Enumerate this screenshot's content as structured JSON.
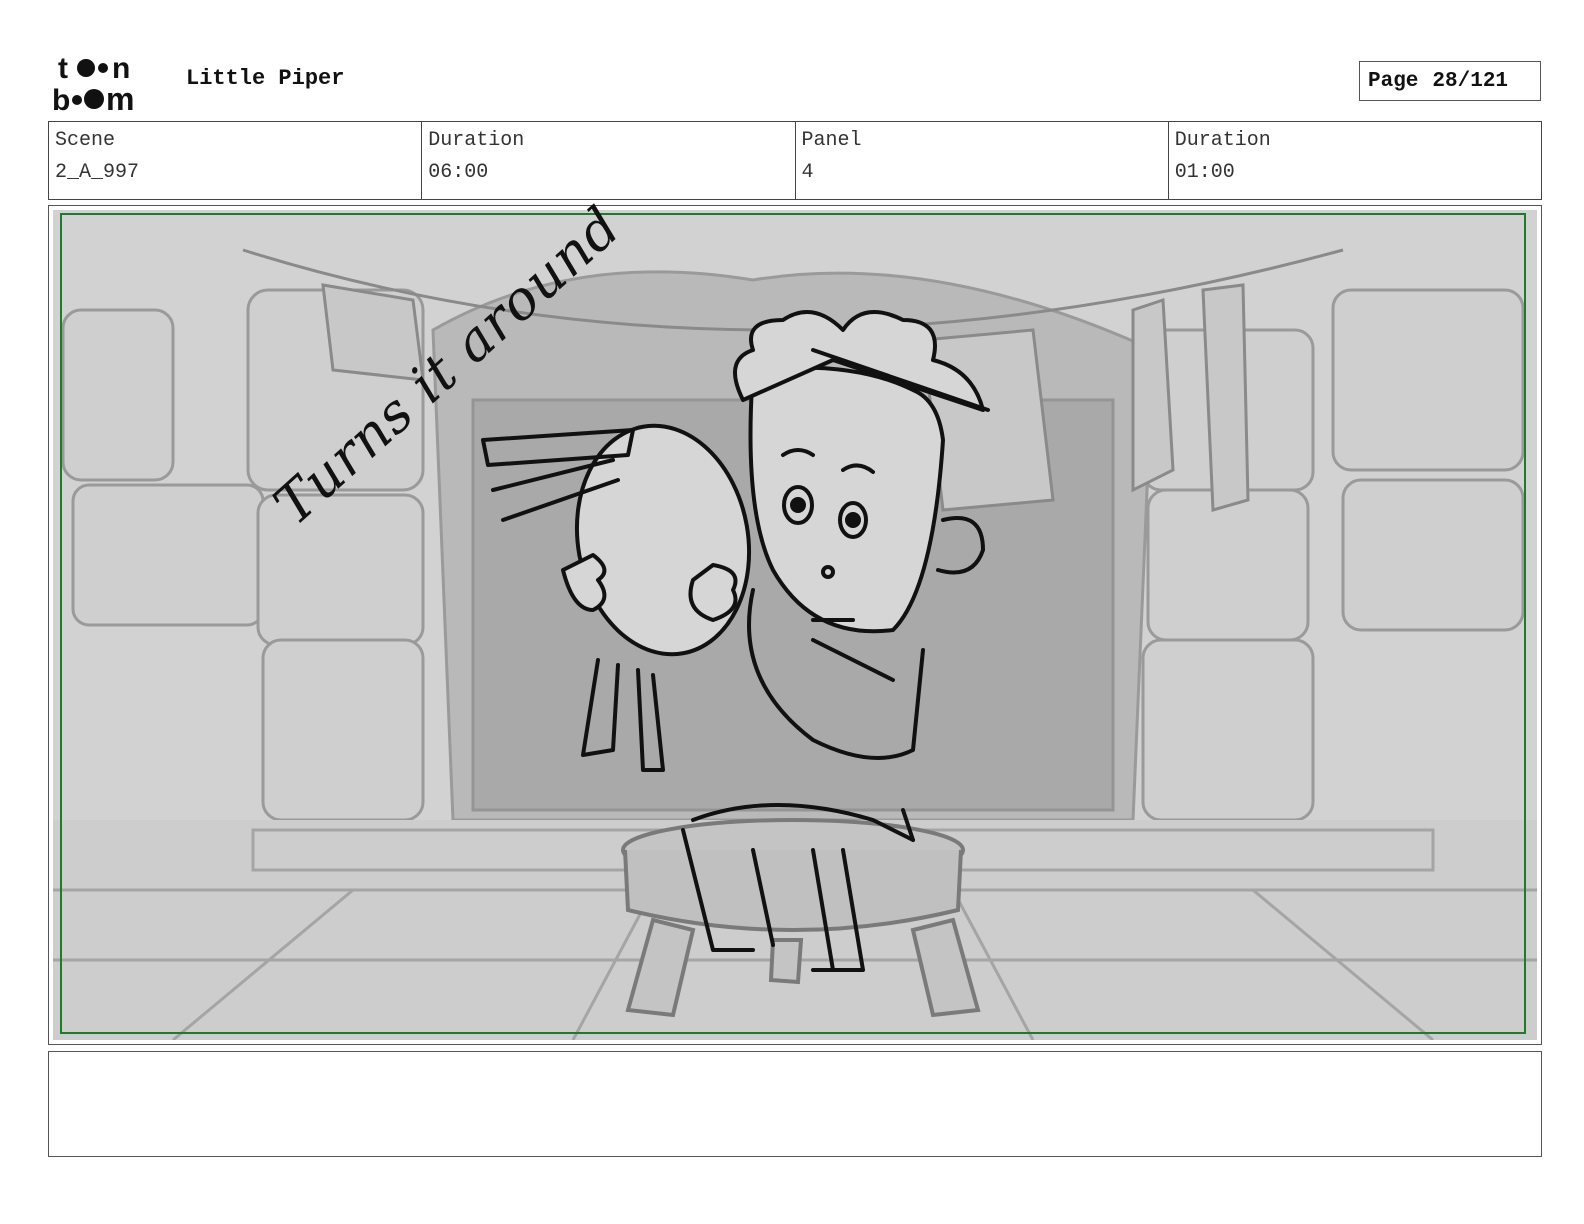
{
  "header": {
    "logo_text": "toon boom",
    "project_title": "Little Piper",
    "page_label": "Page",
    "page_value": "28/121"
  },
  "info": {
    "scene_label": "Scene",
    "scene_value": "2_A_997",
    "scene_duration_label": "Duration",
    "scene_duration_value": "06:00",
    "panel_label": "Panel",
    "panel_value": "4",
    "panel_duration_label": "Duration",
    "panel_duration_value": "01:00"
  },
  "panel": {
    "annotation": "Turns it around",
    "safe_frame_color": "#1f7a2a"
  },
  "notes": {
    "text": ""
  }
}
